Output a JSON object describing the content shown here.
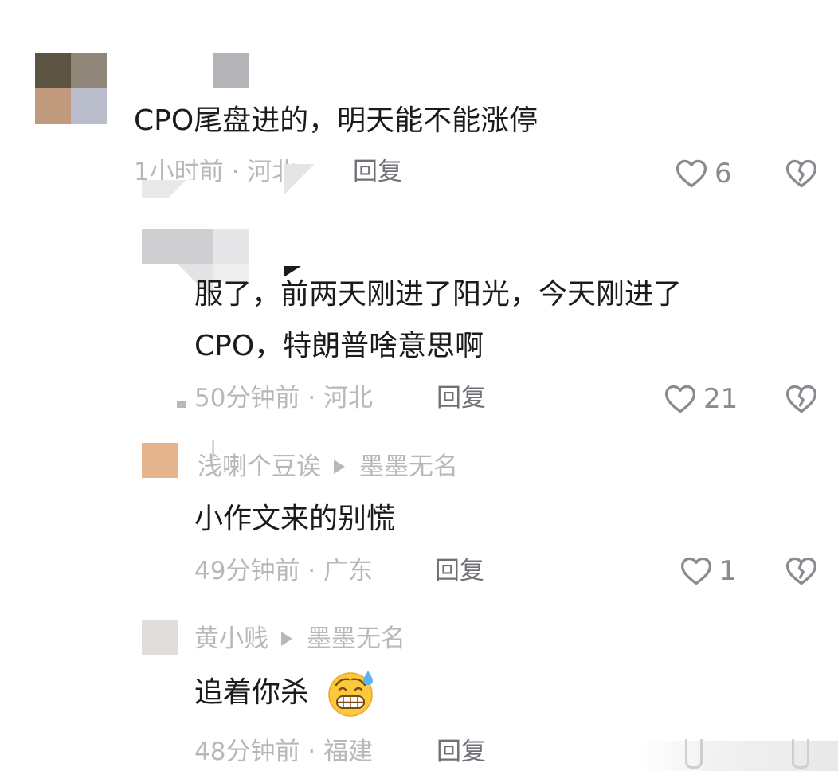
{
  "comments": [
    {
      "text": "CPO尾盘进的，明天能不能涨停",
      "meta": "1小时前 · 河北",
      "reply_label": "回复",
      "likes": "6"
    },
    {
      "text_line1": "服了，前两天刚进了阳光，今天刚进了",
      "text_line2": "CPO，特朗普啥意思啊",
      "meta": "50分钟前 · 河北",
      "reply_label": "回复",
      "likes": "21"
    },
    {
      "user": "浅喇个豆诶",
      "reply_to": "墨墨无名",
      "text": "小作文来的别慌",
      "meta": "49分钟前 · 广东",
      "reply_label": "回复",
      "likes": "1"
    },
    {
      "user": "黄小贱",
      "reply_to": "墨墨无名",
      "text": "追着你杀",
      "meta": "48分钟前 · 福建",
      "reply_label": "回复",
      "emoji": "grimacing-sweat-emoji"
    }
  ],
  "icons": {
    "like": "heart-outline-icon",
    "dislike": "broken-heart-icon"
  },
  "colors": {
    "text": "#1b1b1b",
    "meta": "#b7b8bb",
    "reply": "#6f7177",
    "count": "#8a8b91"
  }
}
